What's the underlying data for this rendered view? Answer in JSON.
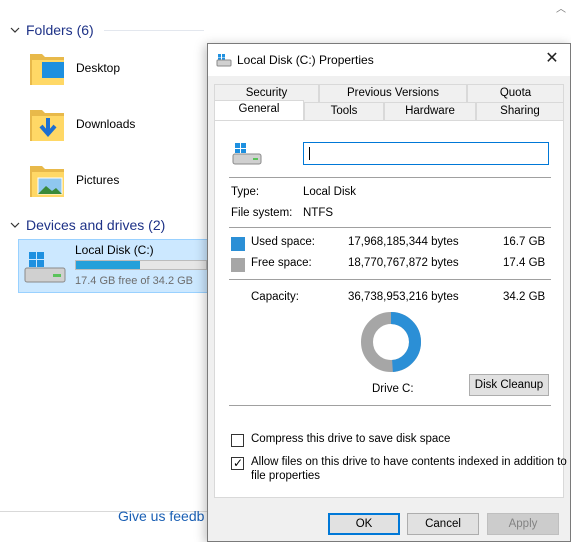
{
  "explorer": {
    "folders_header": "Folders (6)",
    "folders": [
      {
        "label": "Desktop"
      },
      {
        "label": "Downloads"
      },
      {
        "label": "Pictures"
      }
    ],
    "drives_header": "Devices and drives (2)",
    "drive": {
      "name": "Local Disk (C:)",
      "free_text": "17.4 GB free of 34.2 GB",
      "used_fraction": 0.49
    },
    "feedback_link": "Give us feedb"
  },
  "dialog": {
    "title": "Local Disk (C:) Properties",
    "tabs_top": [
      "Security",
      "Previous Versions",
      "Quota"
    ],
    "tabs_bottom": [
      "General",
      "Tools",
      "Hardware",
      "Sharing"
    ],
    "active_tab": "General",
    "volume_name_value": "",
    "type_label": "Type:",
    "type_value": "Local Disk",
    "fs_label": "File system:",
    "fs_value": "NTFS",
    "used_label": "Used space:",
    "used_bytes": "17,968,185,344 bytes",
    "used_gb": "16.7 GB",
    "free_label": "Free space:",
    "free_bytes": "18,770,767,872 bytes",
    "free_gb": "17.4 GB",
    "capacity_label": "Capacity:",
    "capacity_bytes": "36,738,953,216 bytes",
    "capacity_gb": "34.2 GB",
    "drive_label": "Drive C:",
    "disk_cleanup": "Disk Cleanup",
    "compress_label": "Compress this drive to save disk space",
    "compress_checked": false,
    "index_label_line1": "Allow files on this drive to have contents indexed in addition to",
    "index_label_line2": "file properties",
    "index_checked": true,
    "ok": "OK",
    "cancel": "Cancel",
    "apply": "Apply"
  },
  "colors": {
    "used": "#2b8fd6",
    "free": "#a6a6a6",
    "accent": "#0078d7"
  }
}
